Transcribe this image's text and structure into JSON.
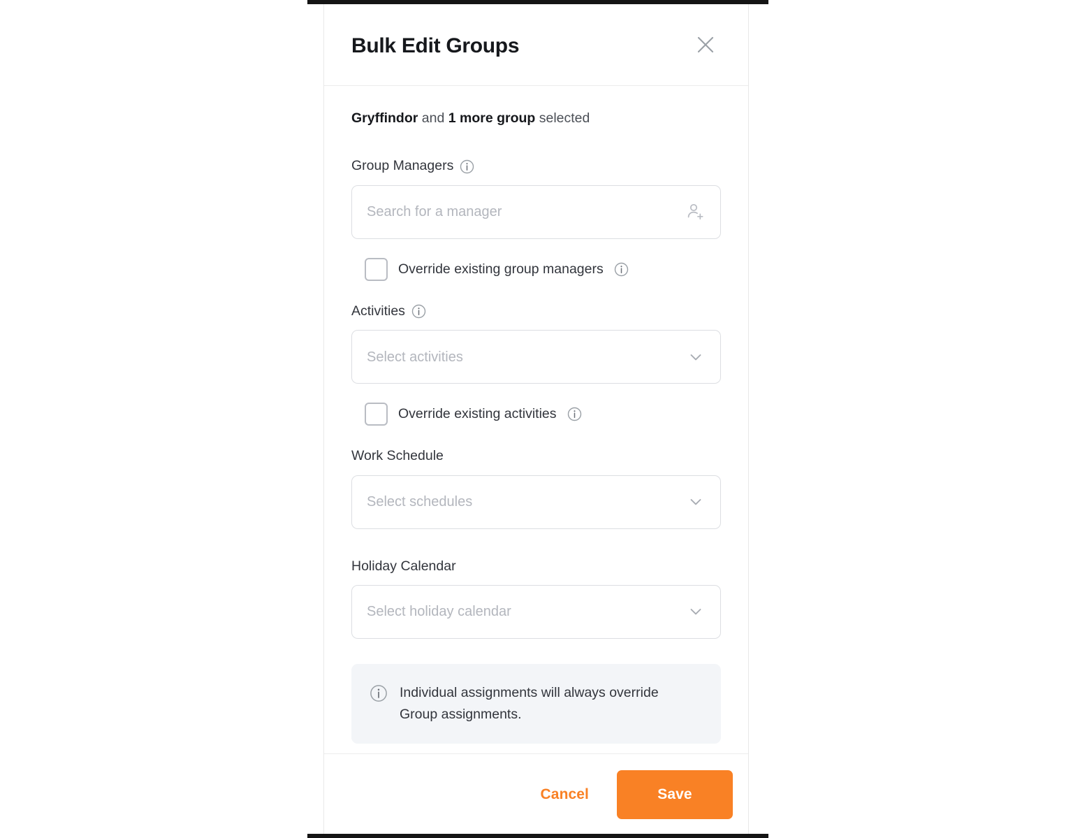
{
  "dialog": {
    "title": "Bulk Edit Groups",
    "close_icon": "close-icon",
    "selection": {
      "group_name": "Gryffindor",
      "connector": " and ",
      "more_count": "1 more group",
      "suffix": " selected"
    },
    "fields": {
      "group_managers": {
        "label": "Group Managers",
        "info_icon": "info-icon",
        "placeholder": "Search for a manager",
        "value": "",
        "trailing_icon": "person-add-icon",
        "override": {
          "label": "Override existing group managers",
          "checked": false,
          "info_icon": "info-icon"
        }
      },
      "activities": {
        "label": "Activities",
        "info_icon": "info-icon",
        "placeholder": "Select activities",
        "value": "",
        "trailing_icon": "chevron-down-icon",
        "override": {
          "label": "Override existing activities",
          "checked": false,
          "info_icon": "info-icon"
        }
      },
      "work_schedule": {
        "label": "Work Schedule",
        "placeholder": "Select schedules",
        "value": "",
        "trailing_icon": "chevron-down-icon"
      },
      "holiday_calendar": {
        "label": "Holiday Calendar",
        "placeholder": "Select holiday calendar",
        "value": "",
        "trailing_icon": "chevron-down-icon"
      }
    },
    "notice": {
      "icon": "info-icon",
      "text": "Individual assignments will always override Group assignments."
    },
    "footer": {
      "cancel_label": "Cancel",
      "save_label": "Save"
    }
  },
  "colors": {
    "accent_orange": "#F98125",
    "text_primary": "#16181C",
    "text_secondary": "#32353C",
    "placeholder": "#B3B6BD",
    "border": "#DCDEE2",
    "banner_bg": "#F3F5F8"
  }
}
